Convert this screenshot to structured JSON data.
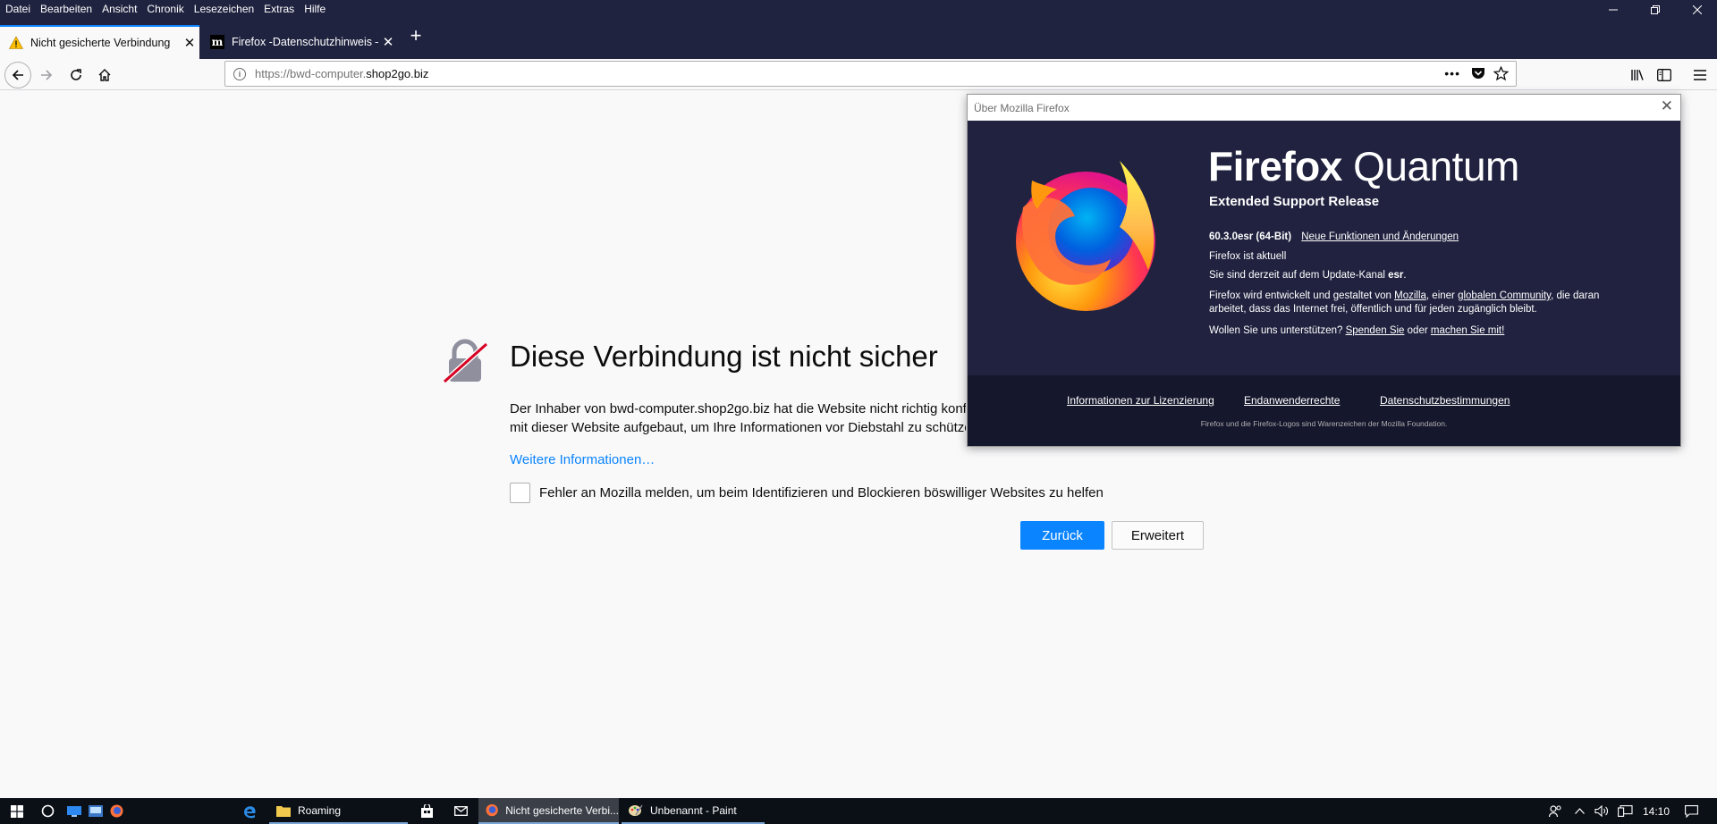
{
  "menubar": {
    "items": [
      "Datei",
      "Bearbeiten",
      "Ansicht",
      "Chronik",
      "Lesezeichen",
      "Extras",
      "Hilfe"
    ],
    "minimize_icon": "minimize-icon",
    "restore_icon": "restore-icon",
    "close_icon": "close-icon"
  },
  "tabs": [
    {
      "title": "Nicht gesicherte Verbindung",
      "icon": "warning-icon",
      "active": true
    },
    {
      "title": "Firefox -Datenschutzhinweis —",
      "icon": "mozilla-m-icon",
      "active": false
    }
  ],
  "navbar": {
    "url_prefix": "https://bwd-computer.",
    "url_domain": "shop2go.biz"
  },
  "error_page": {
    "title": "Diese Verbindung ist nicht sicher",
    "description_line1": "Der Inhaber von bwd-computer.shop2go.biz hat die Website nicht richtig konfiguriert. Firefox hat keine Verbindung",
    "description_line2": "mit dieser Website aufgebaut, um Ihre Informationen vor Diebstahl zu schützen.",
    "learn_more": "Weitere Informationen…",
    "report_label": "Fehler an Mozilla melden, um beim Identifizieren und Blockieren böswilliger Websites zu helfen",
    "back_button": "Zurück",
    "advanced_button": "Erweitert"
  },
  "about_dialog": {
    "window_title": "Über Mozilla Firefox",
    "brand_bold": "Firefox",
    "brand_light": " Quantum",
    "edition": "Extended Support Release",
    "version": "60.3.0esr (64-Bit)",
    "whats_new_link": "Neue Funktionen und Änderungen",
    "status": "Firefox ist aktuell",
    "channel_prefix": "Sie sind derzeit auf dem Update-Kanal ",
    "channel_name": "esr",
    "channel_suffix": ".",
    "community_1": "Firefox wird entwickelt und gestaltet von ",
    "community_mozilla": "Mozilla",
    "community_2": ", einer ",
    "community_global": "globalen Community",
    "community_3": ", die daran",
    "community_line2": "arbeitet, dass das Internet frei, öffentlich und für jeden zugänglich bleibt.",
    "support_1": "Wollen Sie uns unterstützen? ",
    "support_donate": "Spenden Sie",
    "support_2": " oder ",
    "support_join": "machen Sie mit!",
    "footer_links": [
      "Informationen zur Lizenzierung",
      "Endanwenderrechte",
      "Datenschutzbestimmungen"
    ],
    "trademark": "Firefox und die Firefox-Logos sind Warenzeichen der Mozilla Foundation."
  },
  "taskbar": {
    "apps": [
      {
        "label": "Roaming",
        "icon": "folder-icon"
      },
      {
        "label": "Nicht gesicherte Verbi...",
        "icon": "firefox-icon"
      },
      {
        "label": "Unbenannt - Paint",
        "icon": "paint-icon"
      }
    ],
    "clock": "14:10"
  },
  "colors": {
    "chrome_dark": "#202340",
    "accent_blue": "#0a84ff",
    "dialog_dark": "#20223f",
    "taskbar": "#0b1017"
  }
}
